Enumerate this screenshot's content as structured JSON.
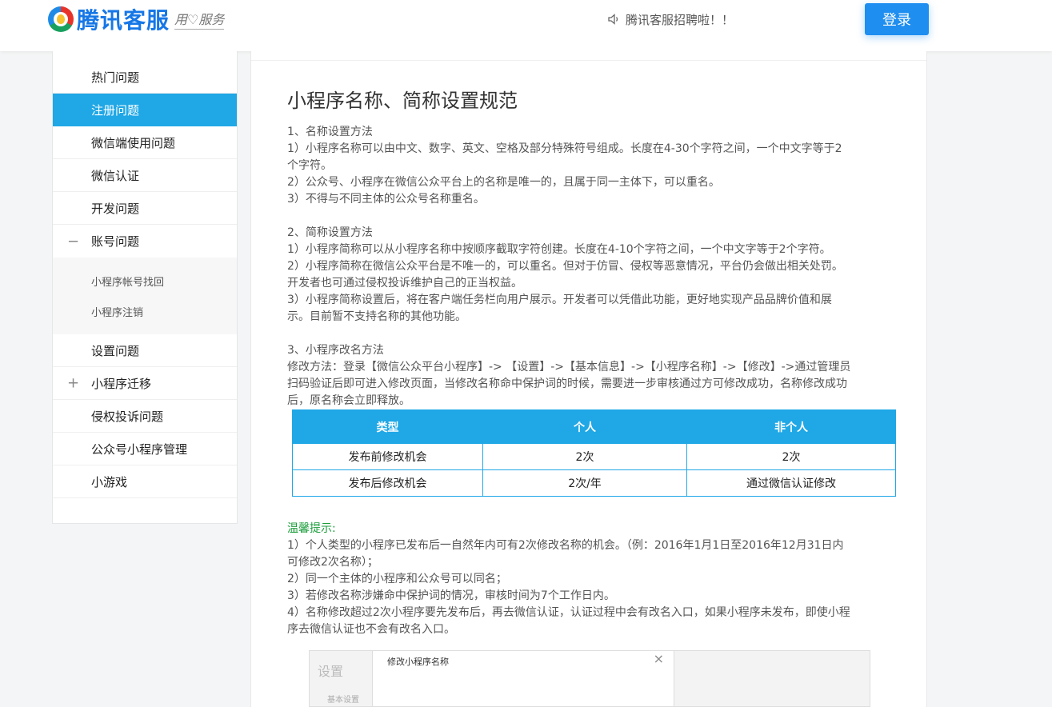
{
  "header": {
    "logo_text": "腾讯客服",
    "logo_slogan": "用♡服务",
    "notice": "腾讯客服招聘啦！！",
    "login_label": "登录"
  },
  "sidebar": {
    "items": [
      {
        "label": "热门问题",
        "toggle": ""
      },
      {
        "label": "注册问题",
        "toggle": "",
        "active": true
      },
      {
        "label": "微信端使用问题",
        "toggle": ""
      },
      {
        "label": "微信认证",
        "toggle": ""
      },
      {
        "label": "开发问题",
        "toggle": ""
      },
      {
        "label": "账号问题",
        "toggle": "−"
      },
      {
        "label": "设置问题",
        "toggle": ""
      },
      {
        "label": "小程序迁移",
        "toggle": "+"
      },
      {
        "label": "侵权投诉问题",
        "toggle": ""
      },
      {
        "label": "公众号小程序管理",
        "toggle": ""
      },
      {
        "label": "小游戏",
        "toggle": ""
      }
    ],
    "sub_items": [
      "小程序帐号找回",
      "小程序注销"
    ]
  },
  "article": {
    "title": "小程序名称、简称设置规范",
    "section1": [
      "1、名称设置方法",
      "1）小程序名称可以由中文、数字、英文、空格及部分特殊符号组成。长度在4-30个字符之间，一个中文字等于2",
      "个字符。",
      "2）公众号、小程序在微信公众平台上的名称是唯一的，且属于同一主体下，可以重名。",
      "3）不得与不同主体的公众号名称重名。"
    ],
    "section2": [
      "2、简称设置方法",
      "1）小程序简称可以从小程序名称中按顺序截取字符创建。长度在4-10个字符之间，一个中文字等于2个字符。",
      "2）小程序简称在微信公众平台是不唯一的，可以重名。但对于仿冒、侵权等恶意情况，平台仍会做出相关处罚。",
      "开发者也可通过侵权投诉维护自己的正当权益。",
      "3）小程序简称设置后，将在客户端任务栏向用户展示。开发者可以凭借此功能，更好地实现产品品牌价值和展",
      "示。目前暂不支持名称的其他功能。"
    ],
    "section3": [
      "3、小程序改名方法",
      "修改方法：登录【微信公众平台小程序】-> 【设置】->【基本信息】->【小程序名称】->【修改】->通过管理员",
      "扫码验证后即可进入修改页面，当修改名称命中保护词的时候，需要进一步审核通过方可修改成功，名称修改成功",
      "后，原名称会立即释放。"
    ],
    "table": {
      "headers": [
        "类型",
        "个人",
        "非个人"
      ],
      "rows": [
        [
          "发布前修改机会",
          "2次",
          "2次"
        ],
        [
          "发布后修改机会",
          "2次/年",
          "通过微信认证修改"
        ]
      ]
    },
    "tip_title": "温馨提示:",
    "tips": [
      "1）个人类型的小程序已发布后一自然年内可有2次修改名称的机会。（例：2016年1月1日至2016年12月31日内",
      "可修改2次名称）；",
      "2）同一个主体的小程序和公众号可以同名；",
      "3）若修改名称涉嫌命中保护词的情况，审核时间为7个工作日内。",
      "4）名称修改超过2次小程序要先发布后，再去微信认证，认证过程中会有改名入口，如果小程序未发布，即使小程",
      "序去微信认证也不会有改名入口。"
    ],
    "screenshot": {
      "side_title": "设置",
      "side_sub": "基本设置",
      "dialog_title": "修改小程序名称",
      "close_glyph": "×"
    }
  }
}
